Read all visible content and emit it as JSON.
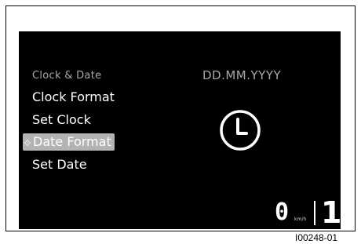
{
  "menu": {
    "header": "Clock & Date",
    "items": [
      {
        "label": "Clock Format",
        "selected": false
      },
      {
        "label": "Set Clock",
        "selected": false
      },
      {
        "label": "Date Format",
        "selected": true
      },
      {
        "label": "Set Date",
        "selected": false
      }
    ]
  },
  "detail": {
    "date_format_value": "DD.MM.YYYY",
    "icon": "clock-icon"
  },
  "status": {
    "speed": "0",
    "speed_unit": "km/h",
    "gear": "1"
  },
  "figure_id": "I00248-01",
  "colors": {
    "screen_bg": "#000000",
    "text": "#ffffff",
    "muted_text": "#a8a8a8",
    "selection_bg": "#b3b3b3"
  }
}
